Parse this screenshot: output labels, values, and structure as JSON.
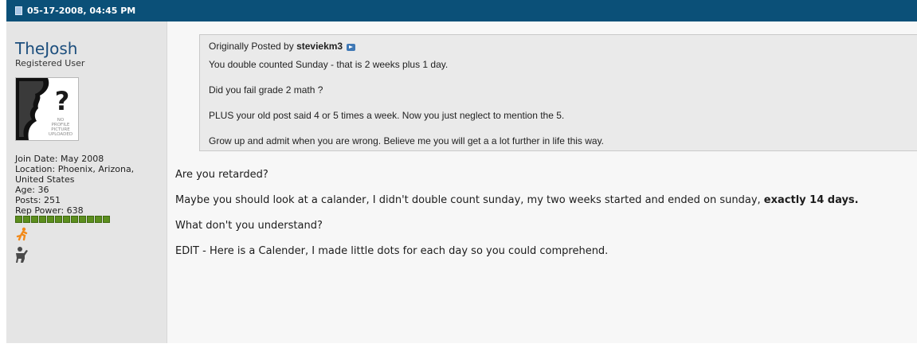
{
  "post": {
    "date": "05-17-2008, 04:45 PM"
  },
  "user": {
    "name": "TheJosh",
    "title": "Registered User",
    "join_date": "Join Date: May 2008",
    "location_line1": "Location: Phoenix, Arizona,",
    "location_line2": "United States",
    "age": "Age: 36",
    "posts": "Posts: 251",
    "rep_power": "Rep Power: 638",
    "rep_blocks": 12,
    "avatar_text": [
      "NO",
      "PROFILE",
      "PICTURE",
      "UPLOADED"
    ]
  },
  "quote": {
    "prefix": "Originally Posted by ",
    "author": "steviekm3",
    "lines": [
      "You double counted Sunday - that is 2 weeks plus 1 day.",
      "Did you fail grade 2 math ?",
      "PLUS your old post said 4 or 5 times a week. Now you just neglect to mention the 5.",
      "Grow up and admit when you are wrong. Believe me you will get a a lot further in life this way."
    ]
  },
  "message": {
    "line1": "Are you retarded?",
    "line2": "Maybe you should look at a calander, I didn't double count sunday, my two weeks started and ended on sunday, ",
    "line2_bold": "exactly 14 days.",
    "line3": "What don't you understand?",
    "line4": "EDIT - Here is a Calender, I made little dots for each day so you could comprehend."
  },
  "colors": {
    "header_bg": "#0b5078",
    "user_col_bg": "#e5e5e5",
    "username": "#1c4e7d",
    "rep_green": "#5c8e1e"
  }
}
